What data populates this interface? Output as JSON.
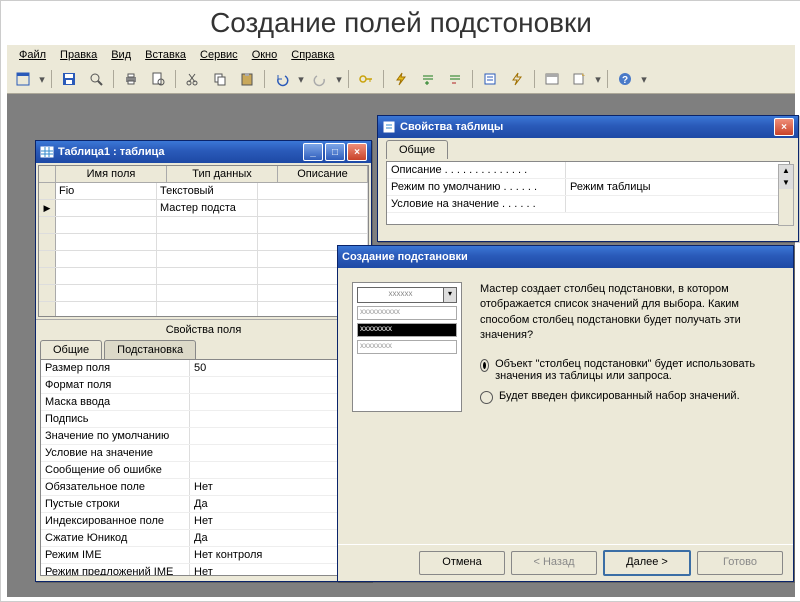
{
  "slide_title": "Создание полей подстоновки",
  "menu": [
    "Файл",
    "Правка",
    "Вид",
    "Вставка",
    "Сервис",
    "Окно",
    "Справка"
  ],
  "table_window": {
    "title": "Таблица1 : таблица",
    "columns": [
      "Имя поля",
      "Тип данных",
      "Описание"
    ],
    "rows": [
      {
        "name": "Fio",
        "type": "Текстовый",
        "desc": ""
      },
      {
        "name": "",
        "type": "Мастер подста",
        "desc": ""
      }
    ],
    "props_header": "Свойства поля",
    "tabs": [
      "Общие",
      "Подстановка"
    ],
    "properties": [
      {
        "label": "Размер поля",
        "value": "50"
      },
      {
        "label": "Формат поля",
        "value": ""
      },
      {
        "label": "Маска ввода",
        "value": ""
      },
      {
        "label": "Подпись",
        "value": ""
      },
      {
        "label": "Значение по умолчанию",
        "value": ""
      },
      {
        "label": "Условие на значение",
        "value": ""
      },
      {
        "label": "Сообщение об ошибке",
        "value": ""
      },
      {
        "label": "Обязательное поле",
        "value": "Нет"
      },
      {
        "label": "Пустые строки",
        "value": "Да"
      },
      {
        "label": "Индексированное поле",
        "value": "Нет"
      },
      {
        "label": "Сжатие Юникод",
        "value": "Да"
      },
      {
        "label": "Режим IME",
        "value": "Нет контроля"
      },
      {
        "label": "Режим предложений IME",
        "value": "Нет"
      }
    ]
  },
  "props_window": {
    "title": "Свойства таблицы",
    "tab": "Общие",
    "rows": [
      {
        "label": "Описание . . . . . . . . . . . . . .",
        "value": ""
      },
      {
        "label": "Режим по умолчанию . . . . . .",
        "value": "Режим таблицы"
      },
      {
        "label": "Условие на значение . . . . . .",
        "value": ""
      }
    ]
  },
  "wizard": {
    "title": "Создание подстановки",
    "sample": [
      "xxxxxxxxxx",
      "xxxxxxxx",
      "xxxxxxxx"
    ],
    "sample_combo": "xxxxxx",
    "question": "Мастер создает столбец подстановки, в котором отображается список значений для выбора. Каким способом столбец подстановки будет получать эти значения?",
    "options": [
      "Объект \"столбец подстановки\" будет использовать значения из таблицы или запроса.",
      "Будет введен фиксированный набор значений."
    ],
    "selected": 0,
    "buttons": {
      "cancel": "Отмена",
      "back": "< Назад",
      "next": "Далее >",
      "finish": "Готово"
    }
  }
}
